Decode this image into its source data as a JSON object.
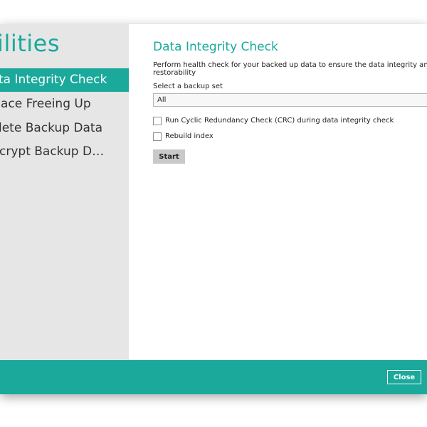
{
  "sidebar": {
    "title": "tilities",
    "items": [
      {
        "label": "ta Integrity Check",
        "active": true
      },
      {
        "label": "ace Freeing Up",
        "active": false
      },
      {
        "label": "lete Backup Data",
        "active": false
      },
      {
        "label": "crypt Backup D…",
        "active": false
      }
    ]
  },
  "content": {
    "title": "Data Integrity Check",
    "description": "Perform health check for your backed up data to ensure the data integrity and restorability",
    "backup_set_label": "Select a backup set",
    "backup_set_value": "All",
    "crc_label": "Run Cyclic Redundancy Check (CRC) during data integrity check",
    "crc_checked": false,
    "rebuild_label": "Rebuild index",
    "rebuild_checked": false,
    "start_label": "Start"
  },
  "footer": {
    "close_label": "Close"
  },
  "colors": {
    "accent": "#1aa99b",
    "sidebar_bg": "#e6e6e6"
  }
}
